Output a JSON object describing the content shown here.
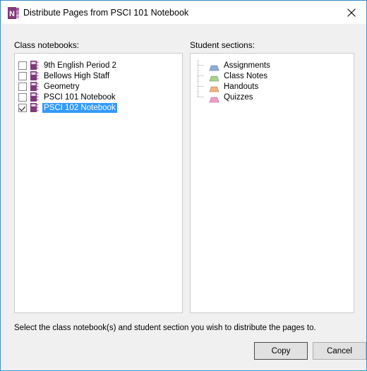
{
  "window": {
    "title": "Distribute Pages from PSCI 101 Notebook",
    "app_icon": "onenote-icon",
    "close_label": "Close",
    "border_color": "#3a92cf"
  },
  "left_panel": {
    "label": "Class notebooks:",
    "items": [
      {
        "label": "9th English  Period 2",
        "checked": false,
        "selected": false,
        "icon": "notebook-icon"
      },
      {
        "label": "Bellows High Staff",
        "checked": false,
        "selected": false,
        "icon": "notebook-icon"
      },
      {
        "label": "Geometry",
        "checked": false,
        "selected": false,
        "icon": "notebook-icon"
      },
      {
        "label": "PSCI 101 Notebook",
        "checked": false,
        "selected": false,
        "icon": "notebook-icon"
      },
      {
        "label": "PSCI 102 Notebook",
        "checked": true,
        "selected": true,
        "icon": "notebook-icon"
      }
    ]
  },
  "right_panel": {
    "label": "Student sections:",
    "items": [
      {
        "label": "Assignments",
        "color": "#8faadc",
        "icon": "section-tab-icon"
      },
      {
        "label": "Class Notes",
        "color": "#a9d18e",
        "icon": "section-tab-icon"
      },
      {
        "label": "Handouts",
        "color": "#f4b183",
        "icon": "section-tab-icon"
      },
      {
        "label": "Quizzes",
        "color": "#ef9cc6",
        "icon": "section-tab-icon"
      }
    ]
  },
  "footer": {
    "instruction": "Select the class notebook(s) and student section you wish to distribute the pages to.",
    "copy_label": "Copy",
    "cancel_label": "Cancel"
  },
  "colors": {
    "selection": "#3399ff",
    "notebook_icon": "#80397b",
    "dialog_background": "#f0f0f0"
  }
}
